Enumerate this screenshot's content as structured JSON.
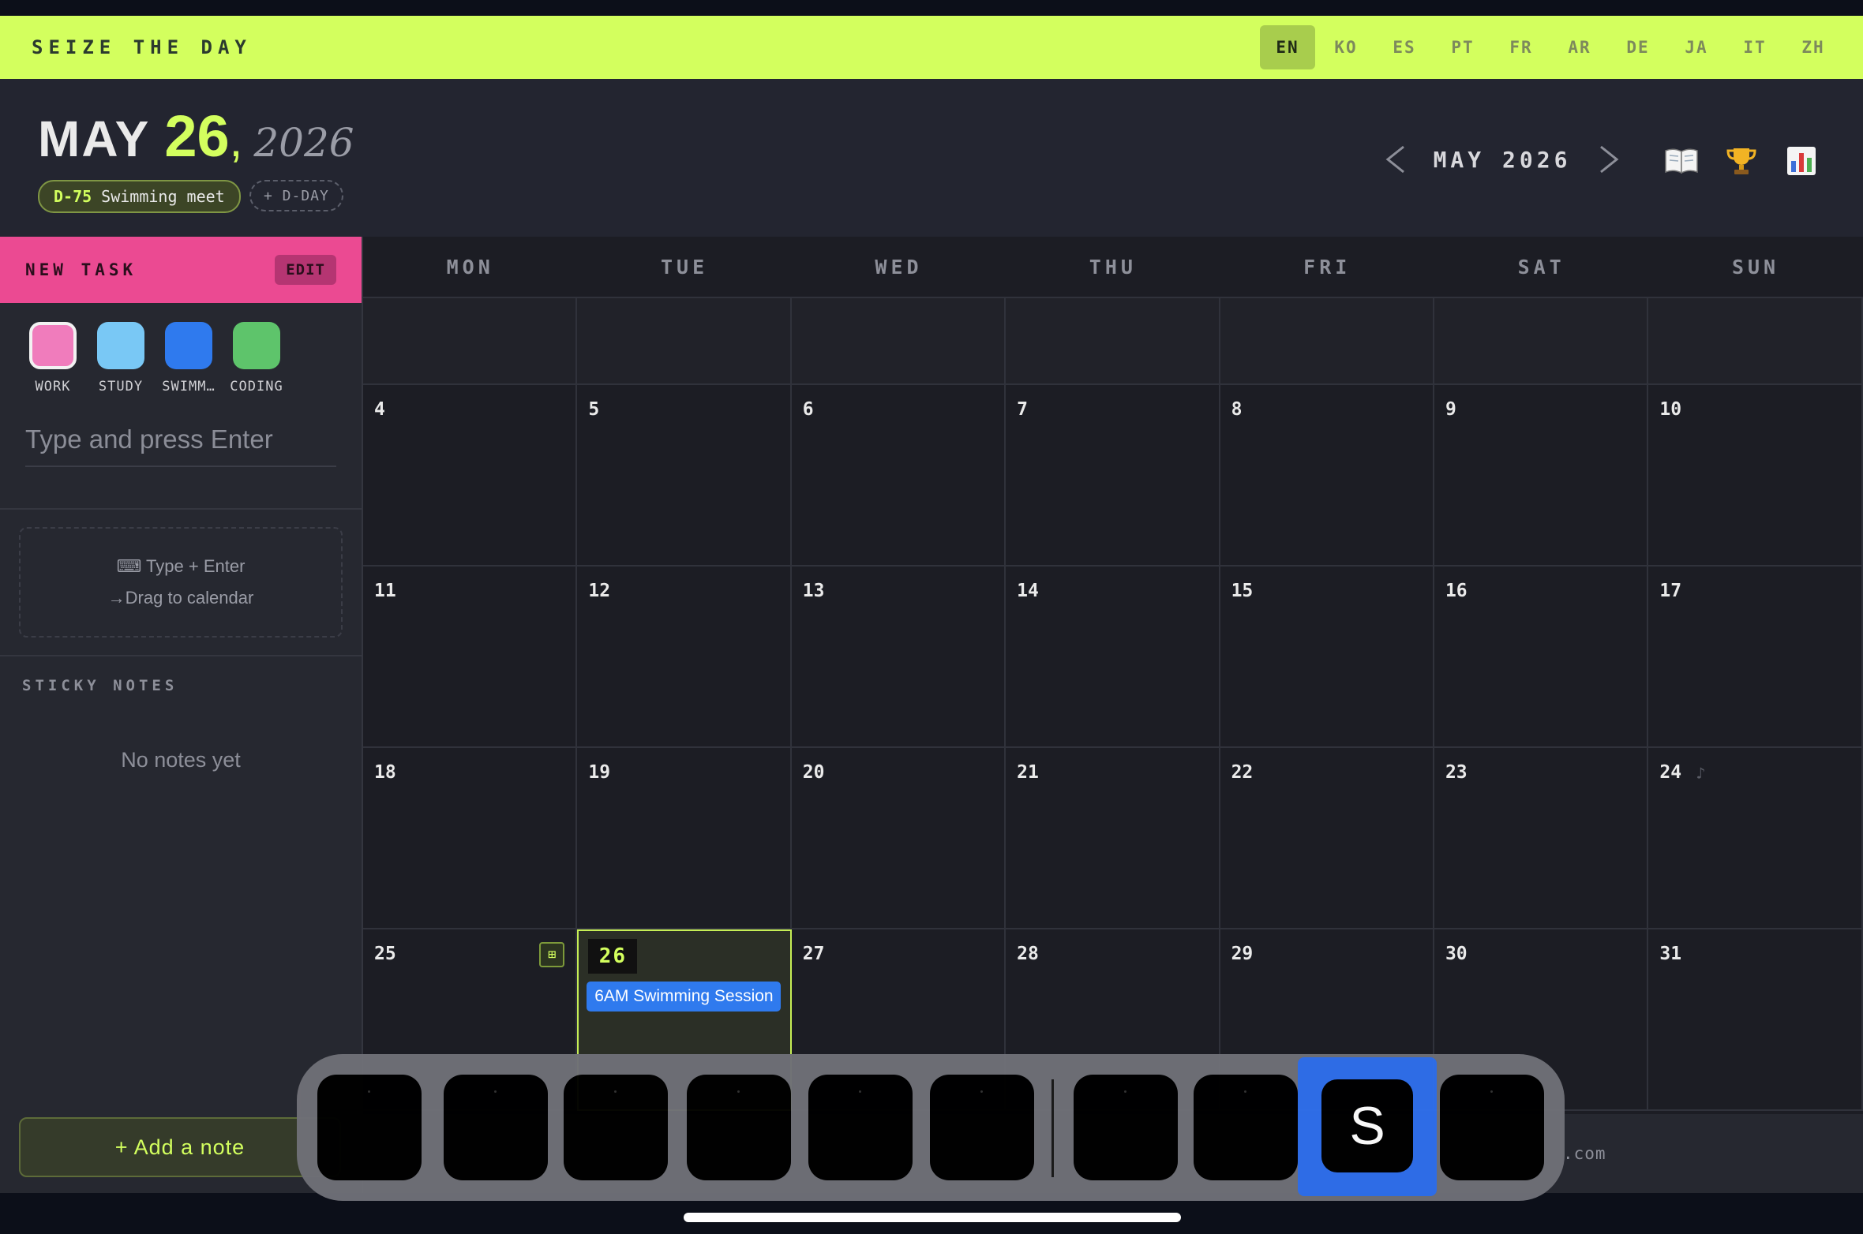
{
  "brand": "SEIZE THE DAY",
  "languages": [
    "EN",
    "KO",
    "ES",
    "PT",
    "FR",
    "AR",
    "DE",
    "JA",
    "IT",
    "ZH"
  ],
  "active_language": "EN",
  "header": {
    "month": "MAY",
    "day": "26",
    "comma": ",",
    "year": "2026",
    "dday_tag": "D-75",
    "dday_label": "Swimming meet",
    "add_dday": "+ D-DAY",
    "month_nav_label": "MAY 2026",
    "tool_icons": [
      "book-icon",
      "trophy-icon",
      "bar-chart-icon"
    ]
  },
  "sidebar": {
    "new_task": "NEW TASK",
    "edit": "EDIT",
    "categories": [
      {
        "label": "WORK",
        "color": "#f07cbc",
        "selected": true
      },
      {
        "label": "STUDY",
        "color": "#79c8f5",
        "selected": false
      },
      {
        "label": "SWIMM…",
        "color": "#2f7aee",
        "selected": false
      },
      {
        "label": "CODING",
        "color": "#5ec46b",
        "selected": false
      }
    ],
    "task_placeholder": "Type and press Enter",
    "hint_line1": "⌨ Type + Enter",
    "hint_line2": "→Drag to calendar",
    "sticky_title": "STICKY NOTES",
    "no_notes": "No notes yet",
    "add_note": "+ Add a note"
  },
  "calendar": {
    "weekdays": [
      "MON",
      "TUE",
      "WED",
      "THU",
      "FRI",
      "SAT",
      "SUN"
    ],
    "weeks": [
      [
        "",
        "",
        "",
        "",
        "",
        "",
        ""
      ],
      [
        "4",
        "5",
        "6",
        "7",
        "8",
        "9",
        "10"
      ],
      [
        "11",
        "12",
        "13",
        "14",
        "15",
        "16",
        "17"
      ],
      [
        "18",
        "19",
        "20",
        "21",
        "22",
        "23",
        "24"
      ],
      [
        "25",
        "26",
        "27",
        "28",
        "29",
        "30",
        "31"
      ]
    ],
    "today": "26",
    "event": {
      "day": "26",
      "title": "6AM Swimming Session",
      "color": "#2f7aee"
    }
  },
  "footer_text": ".com",
  "switcher": {
    "selected_app_letter": "S"
  }
}
